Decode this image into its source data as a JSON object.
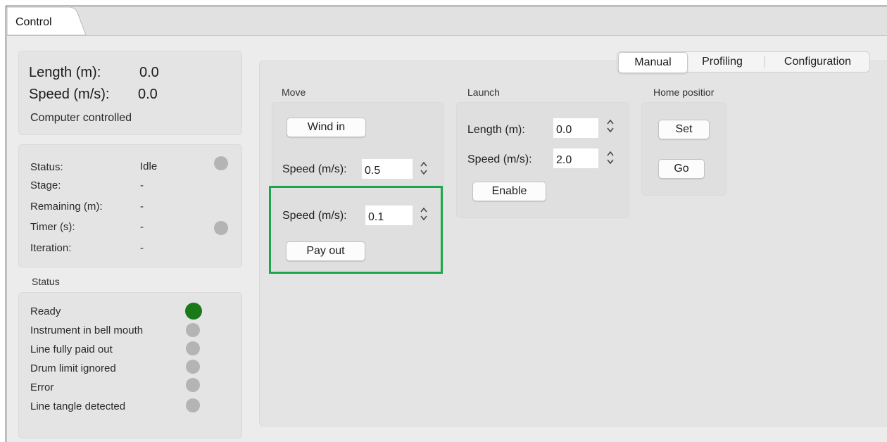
{
  "tabs": {
    "control": "Control"
  },
  "summary": {
    "length_label": "Length (m):",
    "length_value": "0.0",
    "speed_label": "Speed (m/s):",
    "speed_value": "0.0",
    "mode": "Computer controlled"
  },
  "run": {
    "status_label": "Status:",
    "status_value": "Idle",
    "stage_label": "Stage:",
    "stage_value": "-",
    "remaining_label": "Remaining (m):",
    "remaining_value": "-",
    "timer_label": "Timer (s):",
    "timer_value": "-",
    "iteration_label": "Iteration:",
    "iteration_value": "-"
  },
  "status_section": {
    "title": "Status",
    "items": [
      {
        "label": "Ready",
        "state": "on"
      },
      {
        "label": "Instrument in bell mouth",
        "state": "off"
      },
      {
        "label": "Line fully paid out",
        "state": "off"
      },
      {
        "label": "Drum limit ignored",
        "state": "off"
      },
      {
        "label": "Error",
        "state": "off"
      },
      {
        "label": "Line tangle detected",
        "state": "off"
      }
    ]
  },
  "mode_tabs": {
    "manual": "Manual",
    "profiling": "Profiling",
    "configuration": "Configuration",
    "selected": "Manual"
  },
  "move": {
    "title": "Move",
    "wind_in": "Wind in",
    "wind_speed_label": "Speed (m/s):",
    "wind_speed_value": "0.5",
    "pay_speed_label": "Speed (m/s):",
    "pay_speed_value": "0.1",
    "pay_out": "Pay out"
  },
  "launch": {
    "title": "Launch",
    "length_label": "Length (m):",
    "length_value": "0.0",
    "speed_label": "Speed (m/s):",
    "speed_value": "2.0",
    "enable": "Enable"
  },
  "home": {
    "title": "Home positior",
    "set": "Set",
    "go": "Go"
  },
  "colors": {
    "ready": "#1a7a1a",
    "indicator_off": "#b4b4b4",
    "highlight": "#1aa64b"
  }
}
